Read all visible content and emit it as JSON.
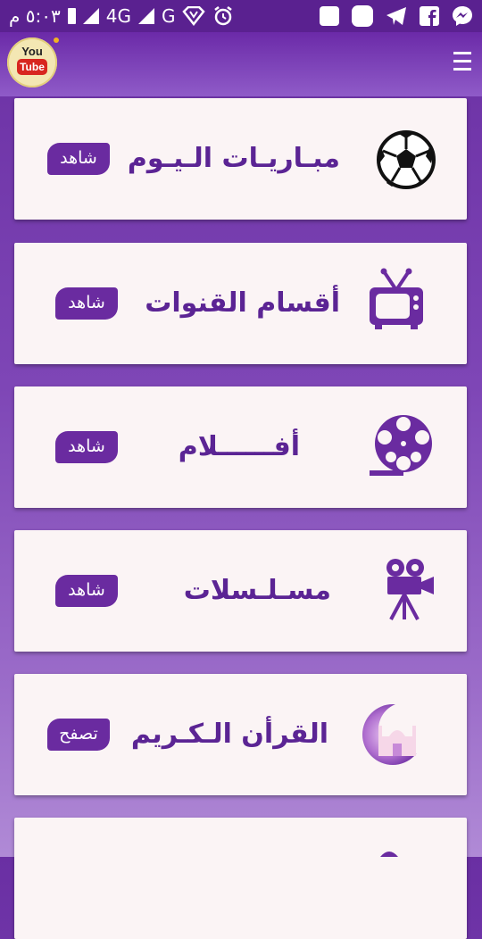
{
  "status_bar": {
    "time": "٥:٠٣ م",
    "network_1": "4G",
    "network_2": "G"
  },
  "header": {
    "logo_top": "You",
    "logo_bottom": "Tube"
  },
  "cards": [
    {
      "title": "مبـاريـات الـيـوم",
      "button": "شاهد",
      "icon": "soccer-ball-icon"
    },
    {
      "title": "أقسام القنوات",
      "button": "شاهد",
      "icon": "tv-icon"
    },
    {
      "title": "أفــــــلام",
      "button": "شاهد",
      "icon": "film-reel-icon"
    },
    {
      "title": "مسـلـسلات",
      "button": "شاهد",
      "icon": "movie-camera-icon"
    },
    {
      "title": "القرأن الـكـريم",
      "button": "تصفح",
      "icon": "mosque-moon-icon"
    }
  ],
  "colors": {
    "accent": "#6a2ba0",
    "title": "#5b2494",
    "card_bg": "#fbf4f5"
  }
}
